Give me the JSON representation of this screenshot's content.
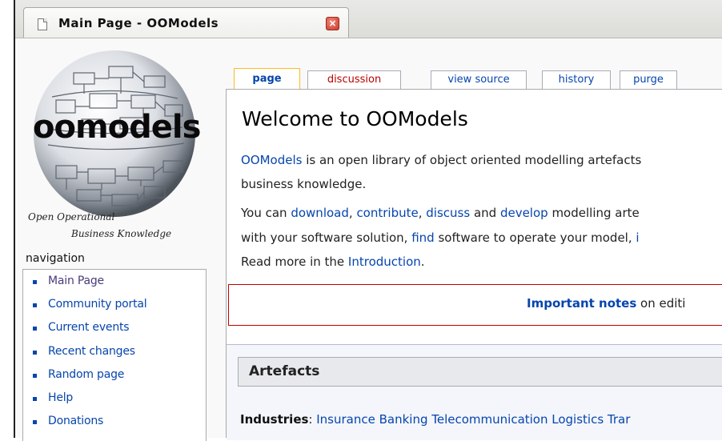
{
  "browser": {
    "tab_title": "Main Page - OOModels",
    "close_glyph": "×"
  },
  "logo": {
    "wordmark": "oomodels",
    "tagline_line1": "Open Operational",
    "tagline_line2": "Business Knowledge"
  },
  "sidebar": {
    "heading": "navigation",
    "items": [
      {
        "label": "Main Page"
      },
      {
        "label": "Community portal"
      },
      {
        "label": "Current events"
      },
      {
        "label": "Recent changes"
      },
      {
        "label": "Random page"
      },
      {
        "label": "Help"
      },
      {
        "label": "Donations"
      }
    ]
  },
  "tabs": {
    "page": "page",
    "discussion": "discussion",
    "view_source": "view source",
    "history": "history",
    "purge": "purge"
  },
  "content": {
    "title": "Welcome to OOModels",
    "p1": {
      "link": "OOModels",
      "text1": " is an open library of object oriented modelling artefacts",
      "text2": "business knowledge."
    },
    "p2": {
      "t1": "You can ",
      "l_download": "download",
      "t2": ", ",
      "l_contribute": "contribute",
      "t3": ", ",
      "l_discuss": "discuss",
      "t4": " and ",
      "l_develop": "develop",
      "t5": " modelling arte",
      "t6": "with your software solution, ",
      "l_find": "find",
      "t7": " software to operate your model, ",
      "l_trail": "i",
      "t8": "Read more in the ",
      "l_intro": "Introduction",
      "t9": "."
    },
    "notes": {
      "bold": "Important notes",
      "rest": " on editi"
    },
    "artefacts": {
      "title": "Artefacts",
      "industries_label": "Industries",
      "colon": ": ",
      "industries_links": "Insurance Banking Telecommunication Logistics Trar"
    }
  },
  "colors": {
    "link": "#0645ad",
    "new_link": "#ba0000",
    "notes_border": "#c00000",
    "active_tab_border": "#fabd23"
  }
}
